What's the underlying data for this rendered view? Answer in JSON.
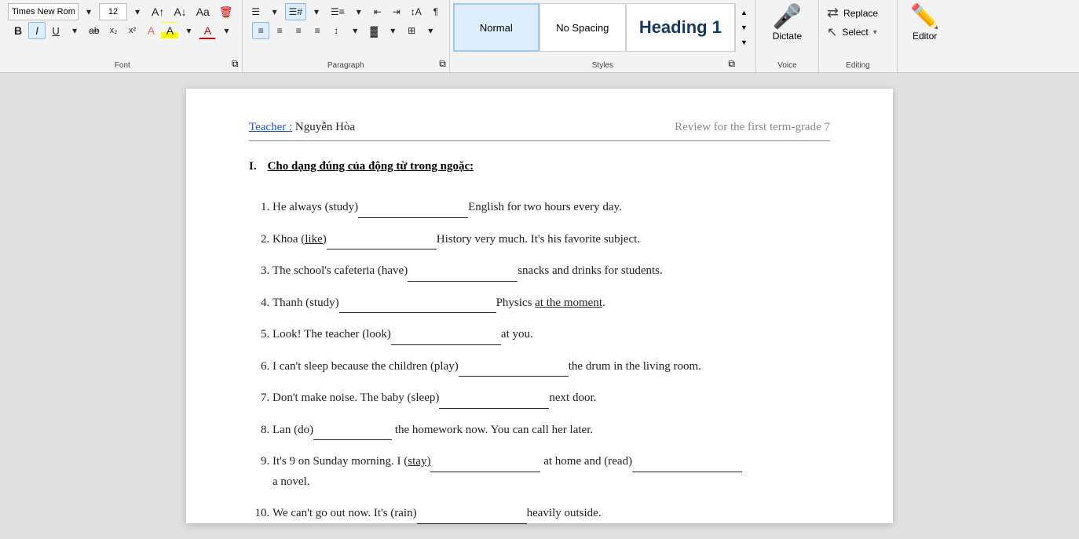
{
  "toolbar": {
    "font": {
      "name": "Times New Roman",
      "size": "12",
      "label": "Font",
      "expand_label": "⌵"
    },
    "paragraph": {
      "label": "Paragraph"
    },
    "styles": {
      "label": "Styles",
      "items": [
        {
          "id": "normal",
          "label": "Normal",
          "active": true
        },
        {
          "id": "nospacing",
          "label": "No Spacing",
          "active": false
        },
        {
          "id": "heading1",
          "label": "Heading 1",
          "active": false
        }
      ]
    },
    "voice": {
      "label": "Voice",
      "dictate": "Dictate"
    },
    "editing": {
      "label": "Editing",
      "replace": "Replace",
      "select": "Select",
      "editor": "Editor"
    }
  },
  "font_buttons": {
    "bold": "B",
    "italic": "I",
    "underline": "U",
    "subscript": "x₂",
    "superscript": "x²",
    "font_color": "A",
    "clear": "🗑"
  },
  "paragraph_buttons": {
    "align_left": "≡",
    "align_center": "≡",
    "align_right": "≡",
    "justify": "≡",
    "bullets": "☰",
    "shading": "▓",
    "borders": "⊞"
  },
  "document": {
    "teacher_label": "Teacher :",
    "teacher_name": " Nguyễn Hòa",
    "doc_title": "Review for the first term-grade 7",
    "section_roman": "I.",
    "section_heading": "Cho dạng đúng của động từ trong ngoặc:",
    "items": [
      {
        "num": 1,
        "text": "He always (study)",
        "blank_size": "medium",
        "text_after": "English for two hours every day."
      },
      {
        "num": 2,
        "text": "Khoa (like)",
        "underline_part": "(like)",
        "blank_size": "medium",
        "text_after": "History very much. It's his favorite subject."
      },
      {
        "num": 3,
        "text": "The school's cafeteria (have)",
        "blank_size": "medium",
        "text_after": "snacks and drinks for students."
      },
      {
        "num": 4,
        "text": "Thanh (study)",
        "blank_size": "long",
        "text_after": "Physics",
        "underline_after": "at the moment",
        "text_end": "."
      },
      {
        "num": 5,
        "text": "Look! The teacher (look)",
        "blank_size": "medium",
        "text_after": "at you."
      },
      {
        "num": 6,
        "text": "I can't sleep because the children (play)",
        "blank_size": "medium",
        "text_after": "the drum in the living room."
      },
      {
        "num": 7,
        "text": "Don't make noise. The baby (sleep)",
        "blank_size": "medium",
        "text_after": "next door."
      },
      {
        "num": 8,
        "text": "Lan (do)",
        "blank_size": "short",
        "text_after": "the homework now. You can call her later."
      },
      {
        "num": 9,
        "text": "It's 9 on Sunday morning. I (stay)",
        "underline_stay": true,
        "blank_size": "medium",
        "text_after": "at home and (read)",
        "blank2_size": "medium",
        "text_end": "a novel."
      },
      {
        "num": 10,
        "text": "We can't go out now. It's (rain)",
        "blank_size": "medium",
        "text_after": "heavily outside."
      }
    ]
  }
}
